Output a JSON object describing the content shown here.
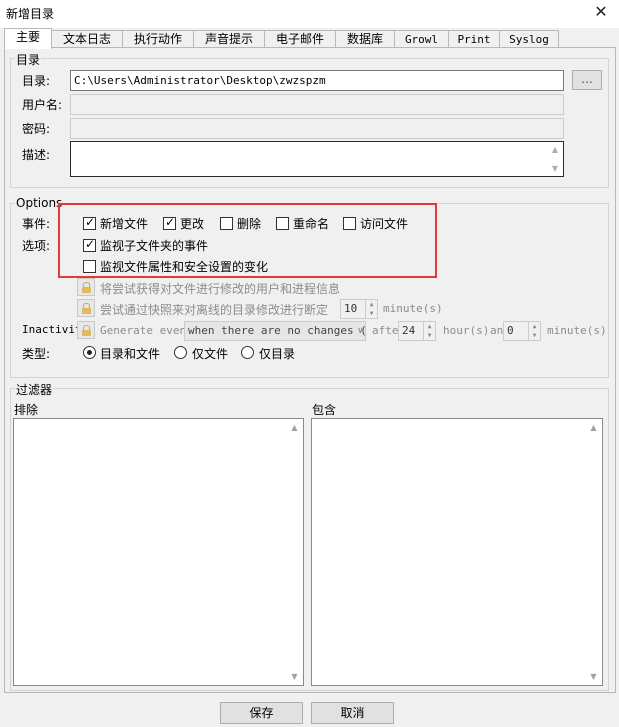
{
  "window": {
    "title": "新增目录"
  },
  "tabs": [
    "主要",
    "文本日志",
    "执行动作",
    "声音提示",
    "电子邮件",
    "数据库",
    "Growl",
    "Print",
    "Syslog"
  ],
  "directory_group": {
    "label": "目录",
    "dir_label": "目录:",
    "dir_value": "C:\\Users\\Administrator\\Desktop\\zwzspzm",
    "browse_label": "...",
    "username_label": "用户名:",
    "password_label": "密码:",
    "description_label": "描述:"
  },
  "options_group": {
    "label": "Options",
    "events_label": "事件:",
    "events": [
      {
        "label": "新增文件",
        "checked": true
      },
      {
        "label": "更改",
        "checked": true
      },
      {
        "label": "删除",
        "checked": false
      },
      {
        "label": "重命名",
        "checked": false
      },
      {
        "label": "访问文件",
        "checked": false
      }
    ],
    "options_label": "选项:",
    "options": [
      {
        "label": "监视子文件夹的事件",
        "checked": true
      },
      {
        "label": "监视文件属性和安全设置的变化",
        "checked": false
      }
    ],
    "locked_options": [
      "将尝试获得对文件进行修改的用户和进程信息",
      "尝试通过快照来对离线的目录修改进行断定"
    ],
    "snapshot_minutes": "10",
    "minute_unit": "minute(s)",
    "inactivity_label": "Inactivit",
    "generate_event_text": "Generate event",
    "inactivity_condition": "when there are no changes (",
    "after_text": "after",
    "after_hours": "24",
    "hour_unit": "hour(s)",
    "and_text": "an",
    "and_minutes": "0",
    "minute_unit2": "minute(s)",
    "type_label": "类型:",
    "types": [
      {
        "label": "目录和文件",
        "selected": true
      },
      {
        "label": "仅文件",
        "selected": false
      },
      {
        "label": "仅目录",
        "selected": false
      }
    ]
  },
  "filter_group": {
    "label": "过滤器",
    "exclude_label": "排除",
    "include_label": "包含"
  },
  "buttons": {
    "save": "保存",
    "cancel": "取消"
  },
  "colors": {
    "highlight": "#e53935",
    "lock": "#e2b95c"
  }
}
